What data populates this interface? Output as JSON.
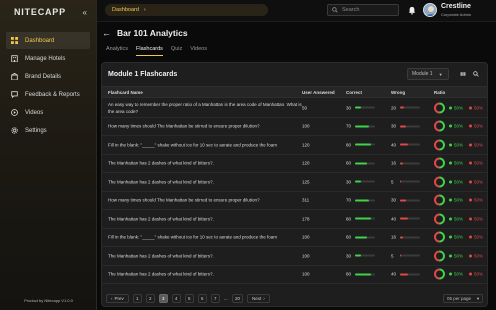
{
  "app": {
    "logo": "NITECAPP",
    "powered_by": "Product by Nitecapp V1.0.0"
  },
  "sidebar": {
    "items": [
      {
        "label": "Dashboard",
        "icon": "dashboard-icon",
        "active": true
      },
      {
        "label": "Manage Hotels",
        "icon": "hotel-icon",
        "active": false
      },
      {
        "label": "Brand Details",
        "icon": "building-icon",
        "active": false
      },
      {
        "label": "Feedback & Reports",
        "icon": "chat-icon",
        "active": false
      },
      {
        "label": "Videos",
        "icon": "play-icon",
        "active": false
      },
      {
        "label": "Settings",
        "icon": "gear-icon",
        "active": false
      }
    ]
  },
  "header": {
    "breadcrumb": "Dashboard",
    "search_placeholder": "Search",
    "user_name": "Crestline",
    "user_role": "Corporate Admin"
  },
  "page": {
    "title": "Bar 101 Analytics",
    "tabs": [
      "Analytics",
      "Flashcards",
      "Quiz",
      "Videos"
    ],
    "active_tab": 1
  },
  "card": {
    "title": "Module 1 Flashcards",
    "module_select": "Module 1",
    "columns": [
      "Flashcard Name",
      "User Answered",
      "Correct",
      "Wrong",
      "Ratio"
    ],
    "rows": [
      {
        "name": "An easy way to remember the proper ratio of a Manhattan is the area code of Manhattan. What is the area code?",
        "users": "50",
        "correct": "30",
        "wrong": "20",
        "correct_pct": "50%",
        "wrong_pct": "50%"
      },
      {
        "name": "How many times should The Manhattan be stirred to ensure proper dilution?",
        "users": "100",
        "correct": "70",
        "wrong": "30",
        "correct_pct": "50%",
        "wrong_pct": "50%"
      },
      {
        "name": "Fill in the blank: \"_____\" shake without ice for 10 sec to aerate and produce the foam",
        "users": "120",
        "correct": "80",
        "wrong": "40",
        "correct_pct": "50%",
        "wrong_pct": "50%"
      },
      {
        "name": "The Manhattan has 2 dashes of what kind of bitters?.",
        "users": "120",
        "correct": "60",
        "wrong": "16",
        "correct_pct": "50%",
        "wrong_pct": "50%"
      },
      {
        "name": "The Manhattan has 2 dashes of what kind of bitters?.",
        "users": "125",
        "correct": "30",
        "wrong": "5",
        "correct_pct": "50%",
        "wrong_pct": "50%"
      },
      {
        "name": "How many times should The Manhattan be stirred to ensure proper dilution?",
        "users": "311",
        "correct": "70",
        "wrong": "30",
        "correct_pct": "50%",
        "wrong_pct": "50%"
      },
      {
        "name": "The Manhattan has 2 dashes of what kind of bitters?.",
        "users": "178",
        "correct": "80",
        "wrong": "40",
        "correct_pct": "50%",
        "wrong_pct": "50%"
      },
      {
        "name": "Fill in the blank: \"_____\" shake without ice for 10 sec to aerate and produce the foam",
        "users": "100",
        "correct": "60",
        "wrong": "16",
        "correct_pct": "50%",
        "wrong_pct": "50%"
      },
      {
        "name": "The Manhattan has 2 dashes of what kind of bitters?.",
        "users": "100",
        "correct": "30",
        "wrong": "5",
        "correct_pct": "50%",
        "wrong_pct": "50%"
      },
      {
        "name": "The Manhattan has 2 dashes of what kind of bitters?.",
        "users": "100",
        "correct": "80",
        "wrong": "40",
        "correct_pct": "50%",
        "wrong_pct": "50%"
      }
    ]
  },
  "pagination": {
    "prev": "Prev",
    "pages": [
      "1",
      "2",
      "3",
      "4",
      "5",
      "6",
      "7"
    ],
    "ellipsis": "...",
    "last_page": "20",
    "next": "Next",
    "active_page": "3",
    "per_page": "05 per page"
  },
  "colors": {
    "accent": "#f2c94c",
    "correct": "#3fd24a",
    "wrong": "#e04848"
  }
}
